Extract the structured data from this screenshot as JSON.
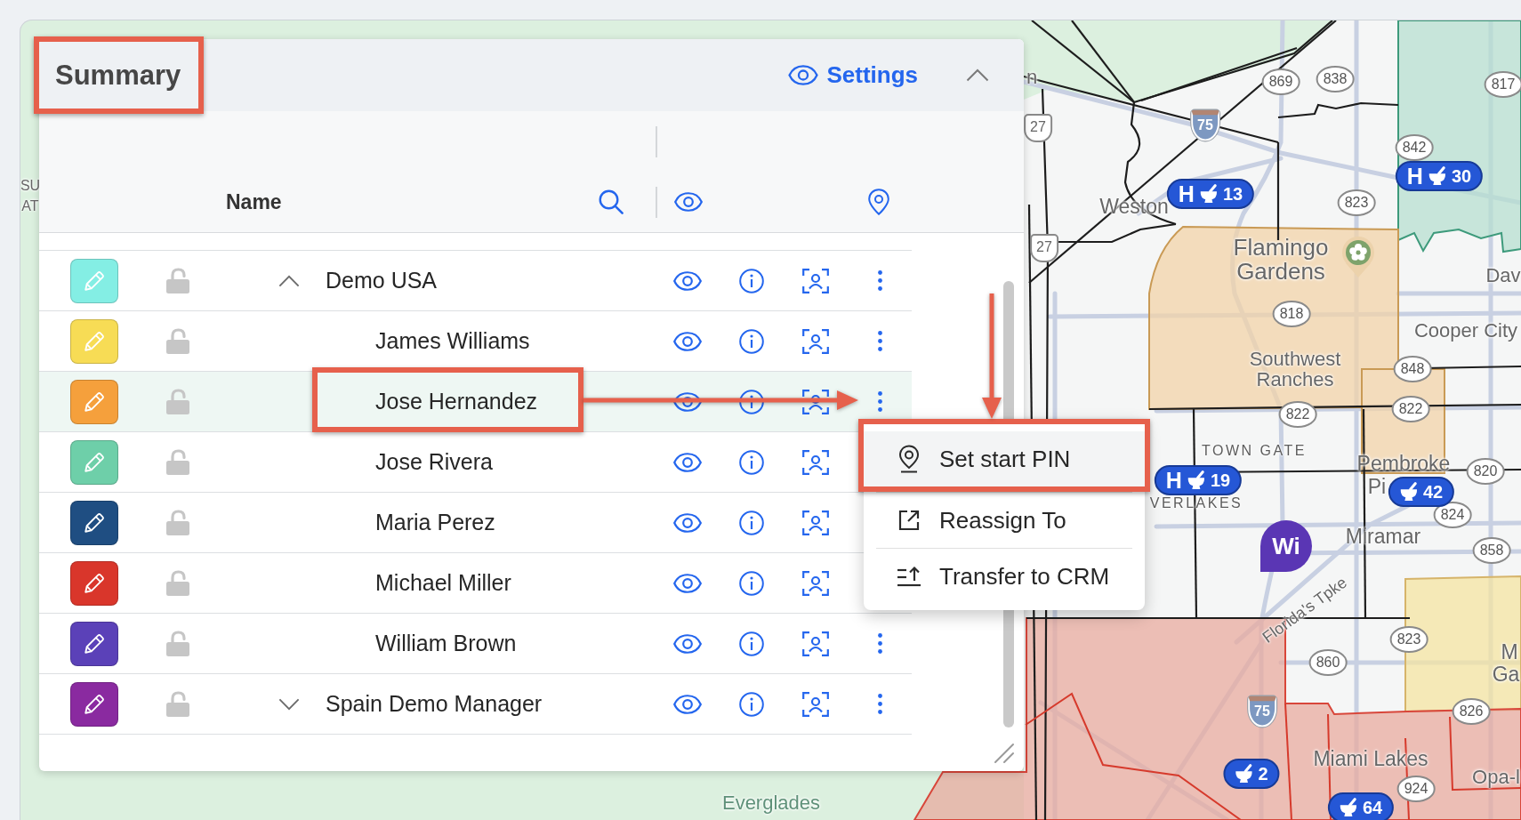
{
  "panel": {
    "title": "Summary",
    "settings_label": "Settings",
    "expanded": true
  },
  "table": {
    "columns": [
      {
        "label": "Name"
      }
    ],
    "rows": [
      {
        "name": "Demo USA",
        "color": "#84eee4",
        "locked": false,
        "expanded": true,
        "selected": false,
        "children": [
          {
            "name": "James Williams",
            "color": "#f7dc55",
            "locked": false,
            "selected": false
          },
          {
            "name": "Jose Hernandez",
            "color": "#f5a03c",
            "locked": false,
            "selected": true
          },
          {
            "name": "Jose Rivera",
            "color": "#6ecfa9",
            "locked": false,
            "selected": false
          },
          {
            "name": "Maria Perez",
            "color": "#1f4e82",
            "locked": false,
            "selected": false
          },
          {
            "name": "Michael Miller",
            "color": "#d9362b",
            "locked": false,
            "selected": false
          },
          {
            "name": "William Brown",
            "color": "#5b41b8",
            "locked": false,
            "selected": false
          }
        ]
      },
      {
        "name": "Spain Demo Manager",
        "color": "#8a2aa0",
        "locked": false,
        "expanded": false,
        "selected": false
      }
    ]
  },
  "context_menu": {
    "items": [
      {
        "kind": "pin",
        "label": "Set start PIN",
        "selected": true
      },
      {
        "kind": "reassign",
        "label": "Reassign To",
        "selected": false
      },
      {
        "kind": "transfer",
        "label": "Transfer to CRM",
        "selected": false
      }
    ]
  },
  "map": {
    "places": [
      "n",
      "Weston",
      "Flamingo Gardens",
      "Southwest Ranches",
      "Dav",
      "Cooper City",
      "TOWN GATE",
      "Pembroke",
      "Pi",
      "VERLAKES",
      "Miramar",
      "Florida's Tpke",
      "M",
      "Ga",
      "Miami Lakes",
      "Opa-l",
      "Everglades",
      "SU",
      "AT"
    ],
    "route_shields": [
      {
        "kind": "state",
        "number": "869"
      },
      {
        "kind": "state",
        "number": "838"
      },
      {
        "kind": "state",
        "number": "817"
      },
      {
        "kind": "interstate",
        "number": "75"
      },
      {
        "kind": "us",
        "number": "27"
      },
      {
        "kind": "state",
        "number": "842"
      },
      {
        "kind": "state",
        "number": "823"
      },
      {
        "kind": "us",
        "number": "27"
      },
      {
        "kind": "state",
        "number": "818"
      },
      {
        "kind": "state",
        "number": "848"
      },
      {
        "kind": "state",
        "number": "822"
      },
      {
        "kind": "state",
        "number": "822"
      },
      {
        "kind": "state",
        "number": "820"
      },
      {
        "kind": "state",
        "number": "824"
      },
      {
        "kind": "state",
        "number": "858"
      },
      {
        "kind": "state",
        "number": "823"
      },
      {
        "kind": "state",
        "number": "860"
      },
      {
        "kind": "interstate",
        "number": "75"
      },
      {
        "kind": "state",
        "number": "826"
      },
      {
        "kind": "state",
        "number": "924"
      }
    ],
    "markers": [
      {
        "kind": "pill",
        "letter": "H",
        "count": "13"
      },
      {
        "kind": "pill",
        "letter": "H",
        "count": "30"
      },
      {
        "kind": "pill",
        "letter": "H",
        "count": "19"
      },
      {
        "kind": "pill",
        "count": "42"
      },
      {
        "kind": "initials",
        "label": "Wi"
      },
      {
        "kind": "pill",
        "count": "2"
      },
      {
        "kind": "pill",
        "count": "64"
      }
    ]
  }
}
